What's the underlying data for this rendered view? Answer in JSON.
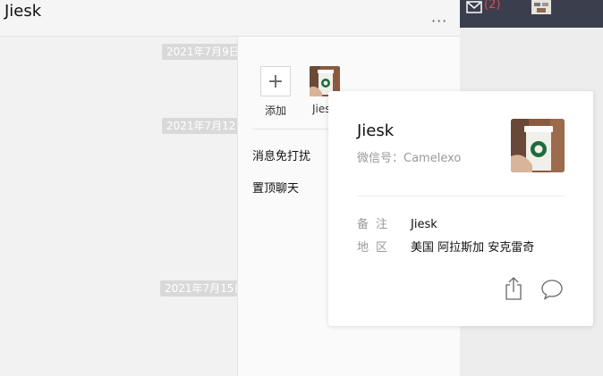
{
  "chat": {
    "title": "Jiesk",
    "more_label": "···",
    "dates": [
      "2021年7月9日",
      "2021年7月12日",
      "2021年7月15日"
    ]
  },
  "panel": {
    "add_icon": "+",
    "add_label": "添加",
    "member_label": "Jiesk",
    "settings": [
      "消息免打扰",
      "置顶聊天"
    ]
  },
  "topbar": {
    "mail_count": "(2)"
  },
  "card": {
    "name": "Jiesk",
    "wechat_id": "微信号：Camelexo",
    "note_key": "备注",
    "note_value": "Jiesk",
    "region_key": "地区",
    "region_value": "美国 阿拉斯加 安克雷奇"
  },
  "icons": [
    "mail-icon",
    "plus-icon",
    "share-icon",
    "chat-bubble-icon"
  ],
  "colors": {
    "topbar": "#3b3f4d",
    "badge": "#e14b4b",
    "date_pill": "#d9d9d9"
  }
}
